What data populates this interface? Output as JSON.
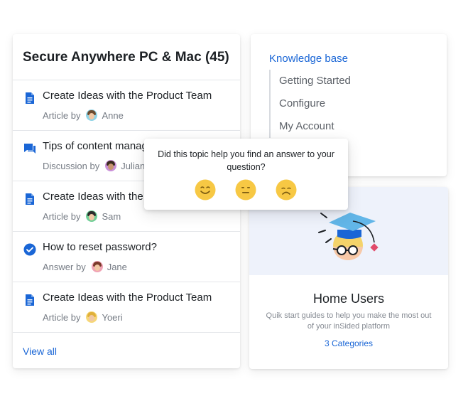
{
  "topics": {
    "title": "Secure Anywhere PC & Mac (45)",
    "items": [
      {
        "title": "Create Ideas with the Product Team",
        "meta_prefix": "Article by",
        "author": "Anne",
        "icon": "article-icon"
      },
      {
        "title": "Tips of content manag",
        "meta_prefix": "Discussion by",
        "author": "Julian",
        "icon": "discussion-icon"
      },
      {
        "title": "Create Ideas with the P",
        "meta_prefix": "Article by",
        "author": "Sam",
        "icon": "article-icon"
      },
      {
        "title": "How to reset password?",
        "meta_prefix": "Answer by",
        "author": "Jane",
        "icon": "answered-check-icon"
      },
      {
        "title": "Create Ideas with the Product Team",
        "meta_prefix": "Article by",
        "author": "Yoeri",
        "icon": "article-icon"
      }
    ],
    "view_all": "View all"
  },
  "knowledge_base": {
    "heading": "Knowledge base",
    "items": [
      "Getting Started",
      "Configure",
      "My Account"
    ]
  },
  "home_users": {
    "title": "Home Users",
    "description": "Quik start guides to help you make the most out of your inSided platform",
    "link": "3 Categories"
  },
  "feedback": {
    "question": "Did this topic help you find an answer to your question?",
    "options": [
      "happy-emoji-icon",
      "neutral-emoji-icon",
      "sad-emoji-icon"
    ]
  },
  "colors": {
    "accent": "#1a66d6",
    "emoji_yellow": "#f7c844",
    "illustration_bg": "#eef2fb"
  }
}
